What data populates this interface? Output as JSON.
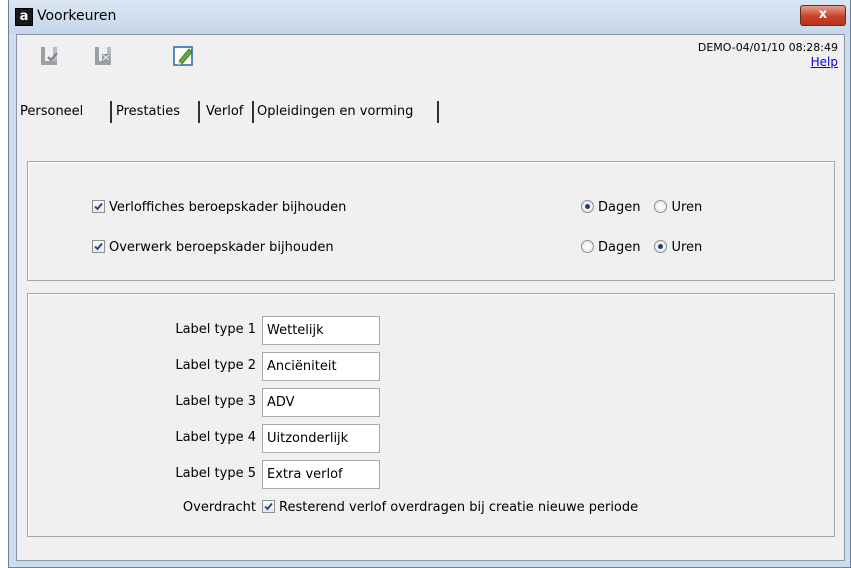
{
  "window": {
    "title": "Voorkeuren",
    "app_icon_letter": "a",
    "close_label": "x"
  },
  "toolbar": {
    "buttons": [
      {
        "icon": "save-check-icon"
      },
      {
        "icon": "save-cancel-icon"
      },
      {
        "icon": "edit-pencil-icon"
      }
    ],
    "status_text": "DEMO-04/01/10 08:28:49",
    "help_label": "Help"
  },
  "tabs": [
    {
      "label": "Personeel",
      "active": false
    },
    {
      "label": "Prestaties",
      "active": false
    },
    {
      "label": "Verlof",
      "active": true
    },
    {
      "label": "Opleidingen en vorming",
      "active": false
    }
  ],
  "verlof": {
    "settings": [
      {
        "label": "Verloffiches beroepskader bijhouden",
        "checked": true,
        "unit_options": [
          "Dagen",
          "Uren"
        ],
        "selected": "Dagen"
      },
      {
        "label": "Overwerk beroepskader bijhouden",
        "checked": true,
        "unit_options": [
          "Dagen",
          "Uren"
        ],
        "selected": "Uren"
      }
    ],
    "label_types": [
      {
        "label": "Label type 1",
        "value": "Wettelijk"
      },
      {
        "label": "Label type 2",
        "value": "Anciëniteit"
      },
      {
        "label": "Label type 3",
        "value": "ADV"
      },
      {
        "label": "Label type 4",
        "value": "Uitzonderlijk"
      },
      {
        "label": "Label type 5",
        "value": "Extra verlof"
      }
    ],
    "overdracht": {
      "label": "Overdracht",
      "checkbox_label": "Resterend verlof overdragen bij creatie nieuwe periode",
      "checked": true
    }
  }
}
